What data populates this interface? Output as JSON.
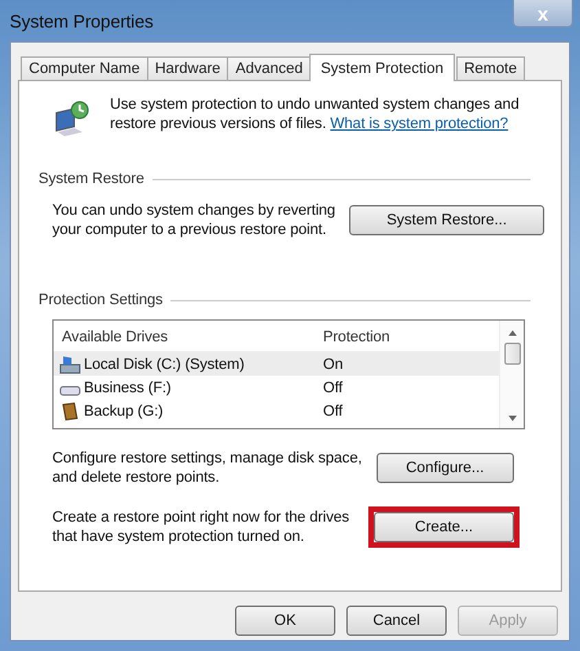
{
  "window": {
    "title": "System Properties",
    "close": "x"
  },
  "tabs": [
    {
      "label": "Computer Name",
      "selected": false
    },
    {
      "label": "Hardware",
      "selected": false
    },
    {
      "label": "Advanced",
      "selected": false
    },
    {
      "label": "System Protection",
      "selected": true
    },
    {
      "label": "Remote",
      "selected": false
    }
  ],
  "intro": {
    "text": "Use system protection to undo unwanted system changes and restore previous versions of files.",
    "link": "What is system protection?"
  },
  "system_restore": {
    "heading": "System Restore",
    "text": "You can undo system changes by reverting your computer to a previous restore point.",
    "button": "System Restore..."
  },
  "protection_settings": {
    "heading": "Protection Settings",
    "columns": [
      "Available Drives",
      "Protection"
    ],
    "drives": [
      {
        "kind": "system",
        "name": "Local Disk (C:) (System)",
        "protection": "On",
        "selected": true
      },
      {
        "kind": "disk",
        "name": "Business (F:)",
        "protection": "Off",
        "selected": false
      },
      {
        "kind": "backup",
        "name": "Backup (G:)",
        "protection": "Off",
        "selected": false
      }
    ],
    "configure_text": "Configure restore settings, manage disk space, and delete restore points.",
    "configure_button": "Configure...",
    "create_text": "Create a restore point right now for the drives that have system protection turned on.",
    "create_button": "Create...",
    "create_highlighted": true
  },
  "buttons": [
    {
      "label": "OK",
      "disabled": false
    },
    {
      "label": "Cancel",
      "disabled": false
    },
    {
      "label": "Apply",
      "disabled": true
    }
  ]
}
